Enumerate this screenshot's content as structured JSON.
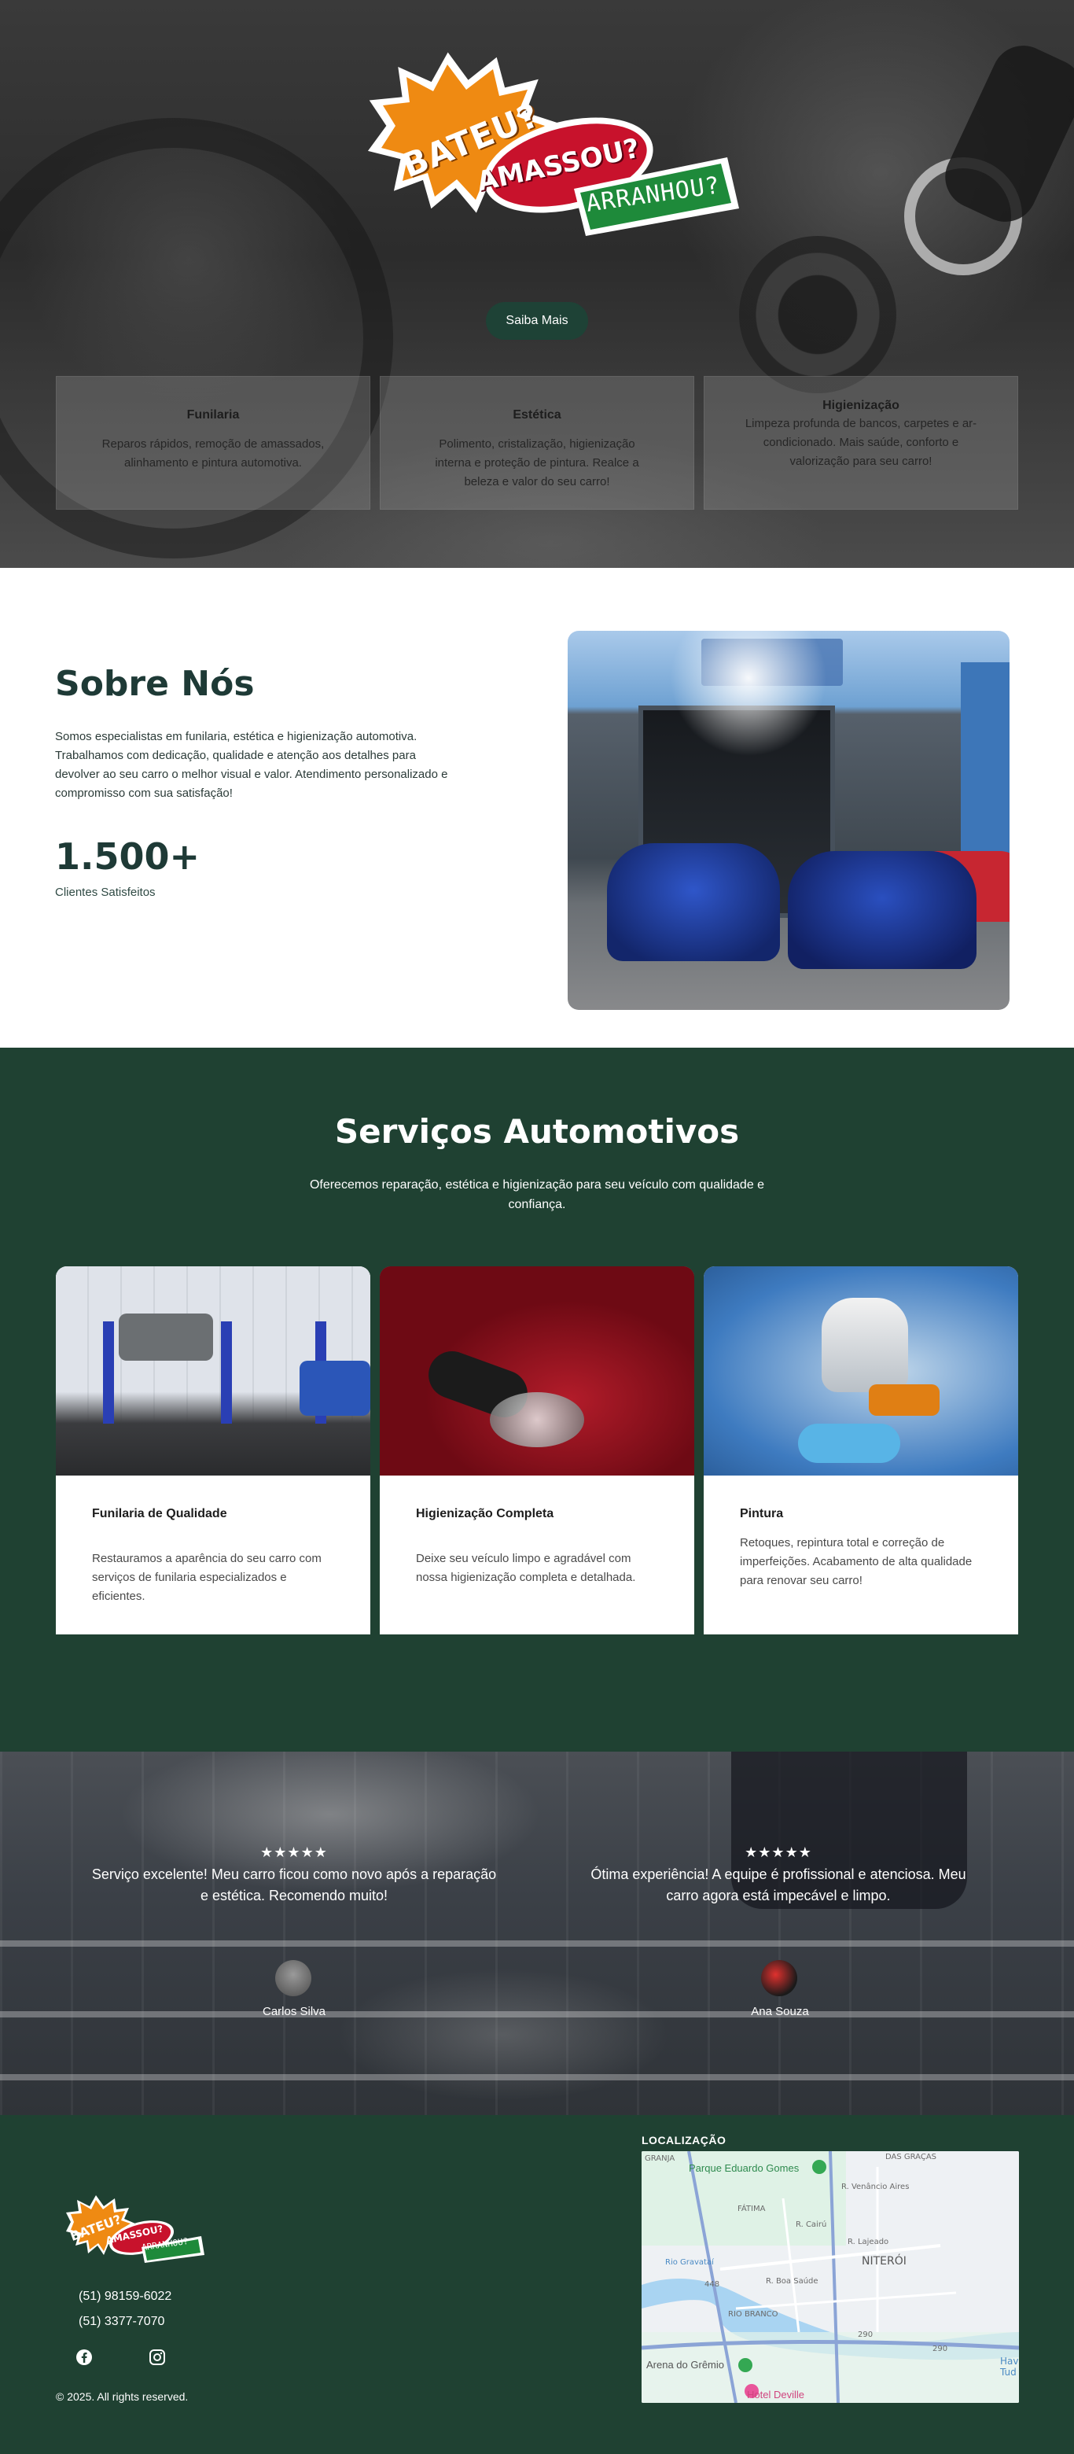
{
  "hero": {
    "logo": {
      "line1": "BATEU?",
      "line2": "AMASSOU?",
      "line3": "ARRANHOU?"
    },
    "cta_label": "Saiba Mais",
    "cards": [
      {
        "title": "Funilaria",
        "text": "Reparos rápidos, remoção de amassados, alinhamento e pintura automotiva."
      },
      {
        "title": "Estética",
        "text": "Polimento, cristalização, higienização interna e proteção de pintura. Realce a beleza e valor do seu carro!"
      },
      {
        "title": "Higienização",
        "text": "Limpeza profunda de bancos, carpetes e ar-condicionado. Mais saúde, conforto e valorização para seu carro!"
      }
    ]
  },
  "about": {
    "title": "Sobre Nós",
    "text": "Somos especialistas em funilaria, estética e higienização automotiva. Trabalhamos com dedicação, qualidade e atenção aos detalhes para devolver ao seu carro o melhor visual e valor. Atendimento personalizado e compromisso com sua satisfação!",
    "stat_value": "1.500+",
    "stat_label": "Clientes Satisfeitos"
  },
  "services": {
    "title": "Serviços Automotivos",
    "subtitle": "Oferecemos reparação, estética e higienização para seu veículo com qualidade e confiança.",
    "cards": [
      {
        "title": "Funilaria de Qualidade",
        "text": "Restauramos a aparência do seu carro com serviços de funilaria especializados e eficientes."
      },
      {
        "title": "Higienização Completa",
        "text": "Deixe seu veículo limpo e agradável com nossa higienização completa e detalhada."
      },
      {
        "title": "Pintura",
        "text": "Retoques, repintura total e correção de imperfeições. Acabamento de alta qualidade para renovar seu carro!"
      }
    ]
  },
  "testimonials": [
    {
      "stars": "★★★★★",
      "quote": "Serviço excelente! Meu carro ficou como novo após a reparação e estética. Recomendo muito!",
      "name": "Carlos Silva"
    },
    {
      "stars": "★★★★★",
      "quote": "Ótima experiência! A equipe é profissional e atenciosa. Meu carro agora está impecável e limpo.",
      "name": "Ana Souza"
    }
  ],
  "footer": {
    "phones": [
      "(51) 98159-6022",
      "(51) 3377-7070"
    ],
    "social_icons": [
      "facebook-icon",
      "instagram-icon"
    ],
    "copyright": "© 2025. All rights reserved.",
    "location_title": "LOCALIZAÇÃO",
    "map_labels": {
      "park": "Parque Eduardo Gomes",
      "neighborhood": "NITERÓI",
      "arena": "Arena do Grêmio",
      "hotel": "Hotel Deville",
      "fatima": "FÁTIMA",
      "rio_branco": "RIO BRANCO",
      "das_gracas": "DAS GRAÇAS",
      "granja": "GRANJA",
      "street1": "R. Boa Saúde",
      "street2": "R. Cairú",
      "street3": "R. Venâncio Aires",
      "street4": "R. Lajeado",
      "river": "Rio Gravataí",
      "route1": "448",
      "route2": "290",
      "route3": "290",
      "partial": "Hav Tud"
    }
  },
  "colors": {
    "dark_green": "#1f4132",
    "button_green": "#1e4236",
    "heading_dark": "#1e3a36",
    "logo_orange": "#ef8a12",
    "logo_red": "#c8122c",
    "logo_green": "#1e8a3a"
  }
}
